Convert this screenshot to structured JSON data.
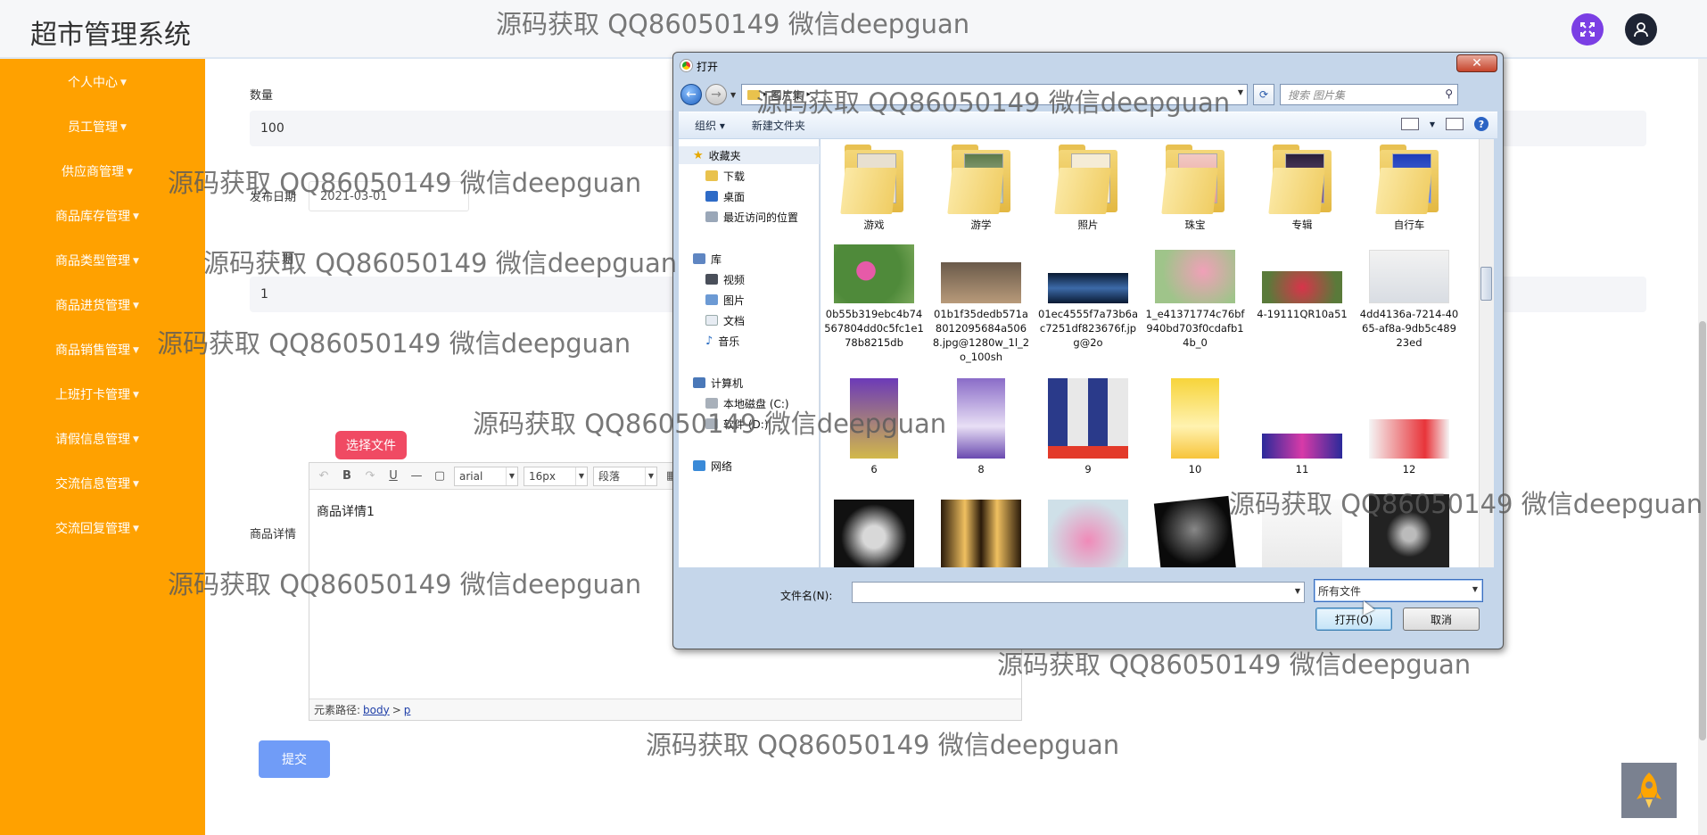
{
  "app": {
    "title": "超市管理系统"
  },
  "sidebar": {
    "items": [
      {
        "label": "个人中心"
      },
      {
        "label": "员工管理"
      },
      {
        "label": "供应商管理"
      },
      {
        "label": "商品库存管理"
      },
      {
        "label": "商品类型管理"
      },
      {
        "label": "商品进货管理"
      },
      {
        "label": "商品销售管理"
      },
      {
        "label": "上班打卡管理"
      },
      {
        "label": "请假信息管理"
      },
      {
        "label": "交流信息管理"
      },
      {
        "label": "交流回复管理"
      }
    ]
  },
  "form": {
    "quantity_label": "数量",
    "quantity_value": "100",
    "date_label": "发布日期",
    "date_value": "2021-03-01",
    "third_label": "期",
    "third_value": "1",
    "choose_file_label": "选择文件",
    "detail_label": "商品详情",
    "editor": {
      "font_family": "arial",
      "font_size": "16px",
      "paragraph": "段落",
      "content": "商品详情1",
      "path_label": "元素路径:",
      "path_body": "body",
      "path_sep": ">",
      "path_p": "p"
    },
    "submit_label": "提交"
  },
  "dialog": {
    "title": "打开",
    "address": "图片集",
    "search_placeholder": "搜索 图片集",
    "toolbar": {
      "organize": "组织 ▾",
      "new_folder": "新建文件夹"
    },
    "nav": {
      "favorites": "收藏夹",
      "downloads": "下载",
      "desktop": "桌面",
      "recent": "最近访问的位置",
      "libraries": "库",
      "videos": "视频",
      "pictures": "图片",
      "documents": "文档",
      "music": "音乐",
      "computer": "计算机",
      "local_disk": "本地磁盘 (C:)",
      "software_disk": "软件 (D:)",
      "network": "网络"
    },
    "folders": [
      "游戏",
      "游学",
      "照片",
      "珠宝",
      "专辑",
      "自行车"
    ],
    "files_row2": [
      "0b55b319ebc4b74567804dd0c5fc1e178b8215db",
      "01b1f35dedb571a8012095684a5068.jpg@1280w_1l_2o_100sh",
      "01ec4555f7a73b6ac7251df823676f.jpg@2o",
      "1_e41371774c76bf940bd703f0cdafb14b_0",
      "4-19111QR10a51",
      "4dd4136a-7214-4065-af8a-9db5c48923ed"
    ],
    "files_row3": [
      "6",
      "8",
      "9",
      "10",
      "11",
      "12"
    ],
    "filename_label": "文件名(N):",
    "filetype_value": "所有文件",
    "open_label": "打开(O)",
    "cancel_label": "取消"
  },
  "watermark": "源码获取 QQ86050149 微信deepguan",
  "colors": {
    "sidebar": "#ffa100",
    "choose_file": "#f04a63",
    "submit": "#709cf7",
    "fullscreen": "#7b3fe4"
  }
}
